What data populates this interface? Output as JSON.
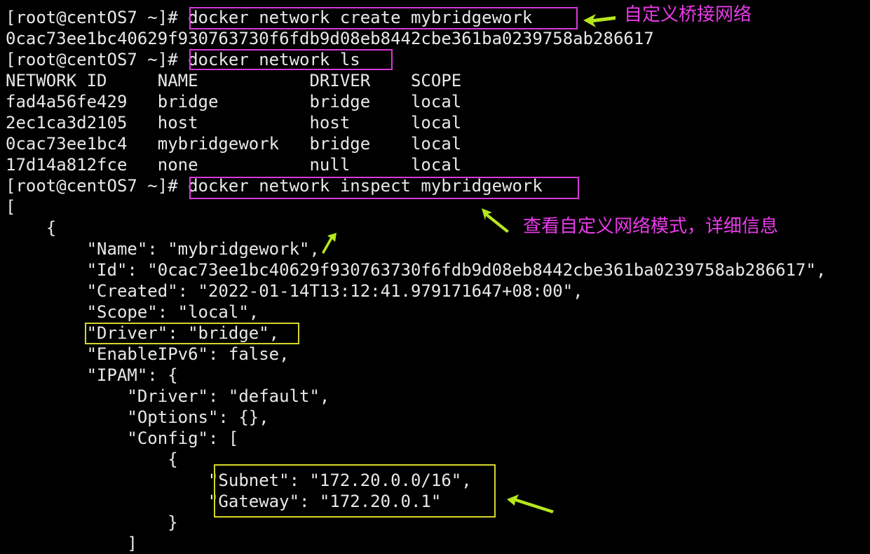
{
  "terminal": {
    "lines": [
      {
        "id": "prompt-1",
        "prompt": "[root@centOS7 ~]#",
        "command": " docker network create mybridgework"
      },
      {
        "id": "output-network-id",
        "text": "0cac73ee1bc40629f930763730f6fdb9d08eb8442cbe361ba0239758ab286617"
      },
      {
        "id": "prompt-2",
        "prompt": "[root@centOS7 ~]#",
        "command": " docker network ls"
      },
      {
        "id": "ls-header",
        "text": "NETWORK ID     NAME           DRIVER    SCOPE"
      },
      {
        "id": "ls-row-1",
        "text": "fad4a56fe429   bridge         bridge    local"
      },
      {
        "id": "ls-row-2",
        "text": "2ec1ca3d2105   host           host      local"
      },
      {
        "id": "ls-row-3",
        "text": "0cac73ee1bc4   mybridgework   bridge    local"
      },
      {
        "id": "ls-row-4",
        "text": "17d14a812fce   none           null      local"
      },
      {
        "id": "prompt-3",
        "prompt": "[root@centOS7 ~]#",
        "command": " docker network inspect mybridgework"
      },
      {
        "id": "json-open-bracket",
        "text": "["
      },
      {
        "id": "json-open-brace",
        "text": "    {"
      },
      {
        "id": "json-name",
        "text": "        \"Name\": \"mybridgework\","
      },
      {
        "id": "json-id",
        "text": "        \"Id\": \"0cac73ee1bc40629f930763730f6fdb9d08eb8442cbe361ba0239758ab286617\","
      },
      {
        "id": "json-created",
        "text": "        \"Created\": \"2022-01-14T13:12:41.979171647+08:00\","
      },
      {
        "id": "json-scope",
        "text": "        \"Scope\": \"local\","
      },
      {
        "id": "json-driver",
        "text": "        \"Driver\": \"bridge\","
      },
      {
        "id": "json-enableipv6",
        "text": "        \"EnableIPv6\": false,"
      },
      {
        "id": "json-ipam",
        "text": "        \"IPAM\": {"
      },
      {
        "id": "json-ipam-driver",
        "text": "            \"Driver\": \"default\","
      },
      {
        "id": "json-ipam-options",
        "text": "            \"Options\": {},"
      },
      {
        "id": "json-ipam-config",
        "text": "            \"Config\": ["
      },
      {
        "id": "json-config-open",
        "text": "                {"
      },
      {
        "id": "json-subnet",
        "text": "                    \"Subnet\": \"172.20.0.0/16\","
      },
      {
        "id": "json-gateway",
        "text": "                    \"Gateway\": \"172.20.0.1\""
      },
      {
        "id": "json-config-close",
        "text": "                }"
      },
      {
        "id": "json-config-array-close",
        "text": "            ]"
      }
    ]
  },
  "annotations": {
    "create_note": "自定义桥接网络",
    "inspect_note": "查看自定义网络模式，详细信息"
  },
  "colors": {
    "background": "#000000",
    "text": "#e8e8e8",
    "magenta_box": "#d83ad8",
    "yellow_box": "#d6d62a",
    "note_text": "#e93be9",
    "arrow": "#b6e61e"
  }
}
